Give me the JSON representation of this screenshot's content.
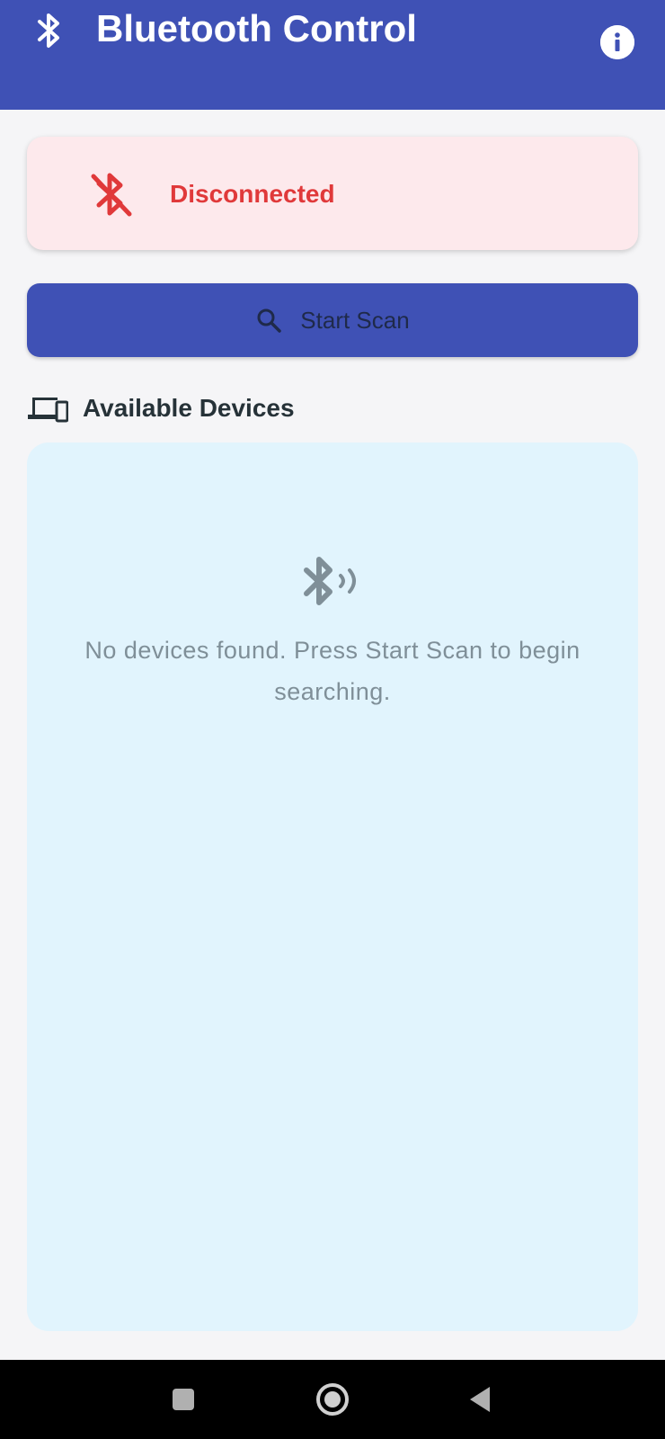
{
  "app_bar": {
    "title": "Bluetooth Control",
    "leading_icon": "bluetooth-icon",
    "action_icon": "info-icon",
    "background": "#3f51b5"
  },
  "status": {
    "text": "Disconnected",
    "icon": "bluetooth-disabled-icon",
    "color": "#e0393a",
    "card_background": "#fde9ec"
  },
  "scan_button": {
    "label": "Start Scan",
    "icon": "search-icon"
  },
  "devices_section": {
    "title": "Available Devices",
    "icon": "devices-icon",
    "empty_icon": "bluetooth-searching-icon",
    "empty_message": "No devices found. Press Start Scan to begin searching.",
    "background": "#e1f4fd"
  },
  "system_nav": {
    "buttons": [
      "recents-icon",
      "home-icon",
      "back-icon"
    ]
  }
}
